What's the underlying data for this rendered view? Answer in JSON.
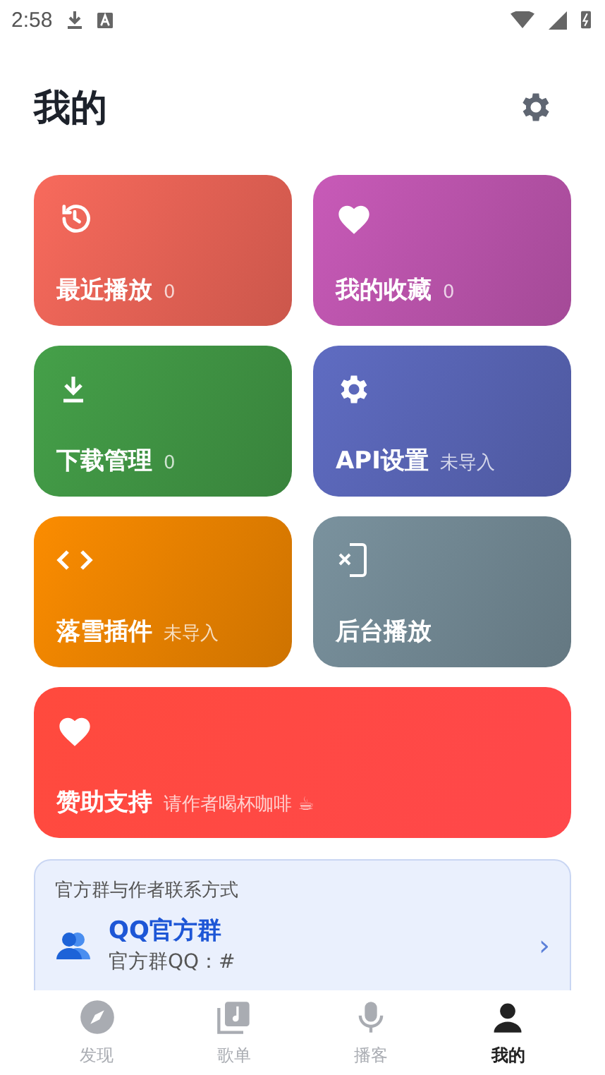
{
  "status_bar": {
    "time": "2:58"
  },
  "header": {
    "title": "我的"
  },
  "cards": [
    {
      "kind": "history",
      "title": "最近播放",
      "note": "0",
      "color": "#f86a5c",
      "wide": false
    },
    {
      "kind": "heart",
      "title": "我的收藏",
      "note": "0",
      "color": "#c85ab8",
      "wide": false
    },
    {
      "kind": "download",
      "title": "下载管理",
      "note": "0",
      "color": "#45a049",
      "wide": false
    },
    {
      "kind": "gear",
      "title": "API设置",
      "note": "未导入",
      "color": "#5f6cc2",
      "wide": false
    },
    {
      "kind": "code",
      "title": "落雪插件",
      "note": "未导入",
      "color": "#fb8c00",
      "wide": false
    },
    {
      "kind": "phone",
      "title": "后台播放",
      "color": "#7a929e",
      "wide": false
    },
    {
      "kind": "heart",
      "title": "赞助支持",
      "note": "请作者喝杯咖啡 ☕",
      "color": "#ff4a3d",
      "wide": true
    }
  ],
  "contact": {
    "heading": "官方群与作者联系方式",
    "name": "QQ官方群",
    "detail": "官方群QQ：#",
    "arrow": "›"
  },
  "nav": [
    {
      "kind": "compass",
      "label": "发现",
      "selected": false
    },
    {
      "kind": "album",
      "label": "歌单",
      "selected": false
    },
    {
      "kind": "mic",
      "label": "播客",
      "selected": false
    },
    {
      "kind": "person",
      "label": "我的",
      "selected": true
    }
  ]
}
